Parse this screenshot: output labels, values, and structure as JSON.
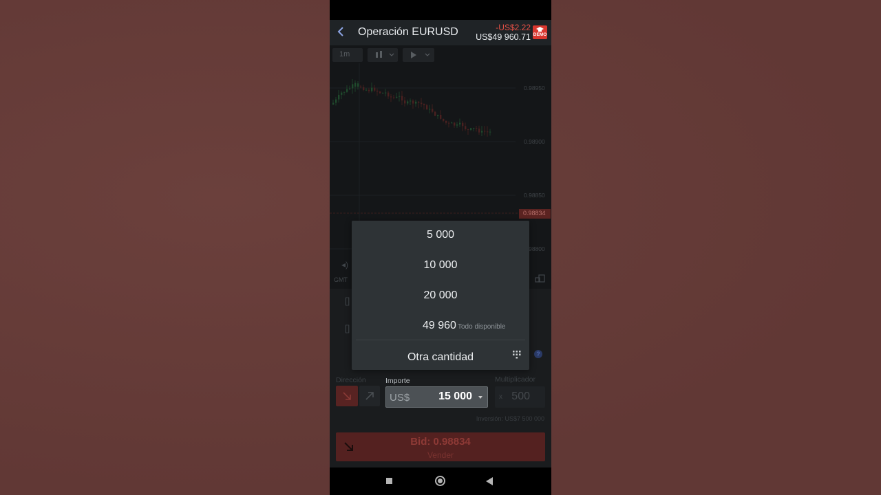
{
  "header": {
    "title": "Operación EURUSD",
    "pnl": "-US$2.22",
    "balance": "US$49 960.71",
    "demo_badge": "DEMO"
  },
  "chart": {
    "timeframe": "1m",
    "price_labels": [
      "0.98950",
      "0.98900",
      "0.98850",
      "0.98800"
    ],
    "current_price": "0.98834",
    "timezone": "GMT"
  },
  "trade": {
    "direction_label": "Dirección",
    "amount_label": "Importe",
    "currency": "US$",
    "amount": "15 000",
    "multiplier_label": "Multiplicador",
    "multiplier": "500",
    "multiplier_prefix": "x",
    "investment_note": "Inversión: US$7 500 000",
    "sell_title": "Bid: 0.98834",
    "sell_subtitle": "Vender"
  },
  "amount_dropdown": {
    "options": [
      "5 000",
      "10 000",
      "20 000"
    ],
    "all_available_value": "49 960",
    "all_available_label": "Todo disponible",
    "other_amount": "Otra cantidad"
  },
  "colors": {
    "page_background": "#663c39",
    "sell": "#d9372f",
    "dropdown_background": "#2e3336"
  }
}
